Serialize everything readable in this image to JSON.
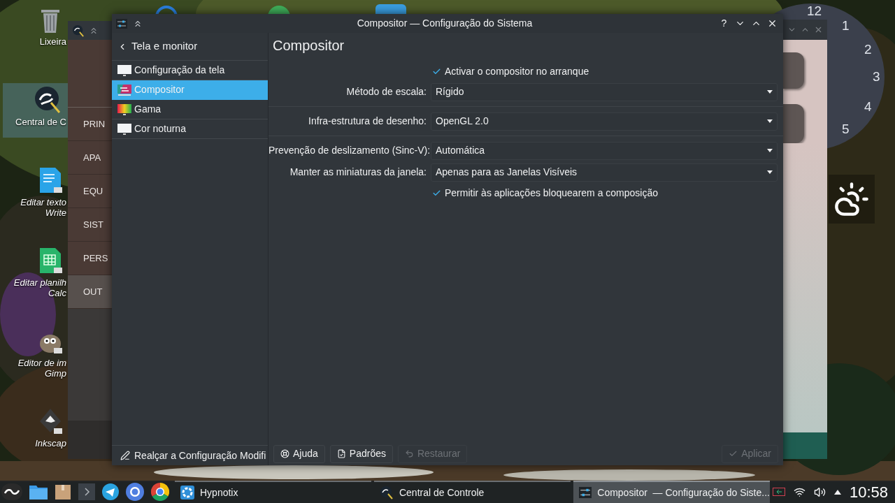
{
  "desktop_icons": [
    {
      "kind": "trash",
      "lines": [
        "Lixeira"
      ],
      "shortcut": false,
      "selected": false
    },
    {
      "kind": "app",
      "lines": [
        "Central de C"
      ],
      "shortcut": false,
      "selected": true
    },
    {
      "kind": "document",
      "lines": [
        "Editar texto",
        "Write"
      ],
      "shortcut": true,
      "selected": false
    },
    {
      "kind": "spreadsheet",
      "lines": [
        "Editar planilh",
        "Calc"
      ],
      "shortcut": true,
      "selected": false
    },
    {
      "kind": "gimp",
      "lines": [
        "Editor de im",
        "Gimp"
      ],
      "shortcut": true,
      "selected": false
    },
    {
      "kind": "vector",
      "lines": [
        "Inkscap"
      ],
      "shortcut": true,
      "selected": false
    }
  ],
  "back_window": {
    "sections": [
      {
        "label": "PRIN",
        "selected": false
      },
      {
        "label": "APA",
        "selected": false
      },
      {
        "label": "EQU",
        "selected": false
      },
      {
        "label": "SIST",
        "selected": false
      },
      {
        "label": "PERS",
        "selected": false
      },
      {
        "label": "OUT",
        "selected": true
      }
    ]
  },
  "clock_widget": {
    "numerals": [
      "12",
      "1",
      "2",
      "3",
      "4",
      "5"
    ]
  },
  "window": {
    "title": "Compositor — Configuração do Sistema",
    "help_glyph": "?",
    "sidebar": {
      "back_label": "Tela e monitor",
      "items": [
        {
          "label": "Configuração da tela",
          "kind": "monitor",
          "selected": false
        },
        {
          "label": "Compositor",
          "kind": "compositor",
          "selected": true
        },
        {
          "label": "Gama",
          "kind": "gamma",
          "selected": false
        },
        {
          "label": "Cor noturna",
          "kind": "monitor",
          "selected": false
        }
      ],
      "footer": "Realçar a Configuração Modifi"
    },
    "page": {
      "heading": "Compositor",
      "groups": [
        [
          {
            "kind": "checkbox",
            "label": "Activar o compositor no arranque",
            "checked": true
          },
          {
            "kind": "combo",
            "label": "Método de escala:",
            "value": "Rígido"
          }
        ],
        [
          {
            "kind": "combo",
            "label": "Infra-estrutura de desenho:",
            "value": "OpenGL 2.0"
          }
        ],
        [
          {
            "kind": "combo",
            "label": "Prevenção de deslizamento (Sinc-V):",
            "value": "Automática"
          },
          {
            "kind": "combo",
            "label": "Manter as miniaturas da janela:",
            "value": "Apenas para as Janelas Visíveis"
          },
          {
            "kind": "checkbox",
            "label": "Permitir às aplicações bloquearem a composição",
            "checked": true
          }
        ]
      ]
    },
    "buttons": [
      {
        "label": "Ajuda",
        "kind": "help",
        "disabled": false
      },
      {
        "label": "Padrões",
        "kind": "defaults",
        "disabled": false
      },
      {
        "label": "Restaurar",
        "kind": "reset",
        "disabled": true
      },
      {
        "label": "Aplicar",
        "kind": "apply",
        "disabled": true
      }
    ]
  },
  "taskbar": {
    "tasks": [
      {
        "label": "Hypnotix",
        "kind": "tv",
        "active": false
      },
      {
        "label": "Central de Controle",
        "kind": "app",
        "active": false
      },
      {
        "label": "Compositor  — Configuração do Siste...",
        "kind": "settings",
        "active": true
      }
    ],
    "clock": "10:58"
  }
}
